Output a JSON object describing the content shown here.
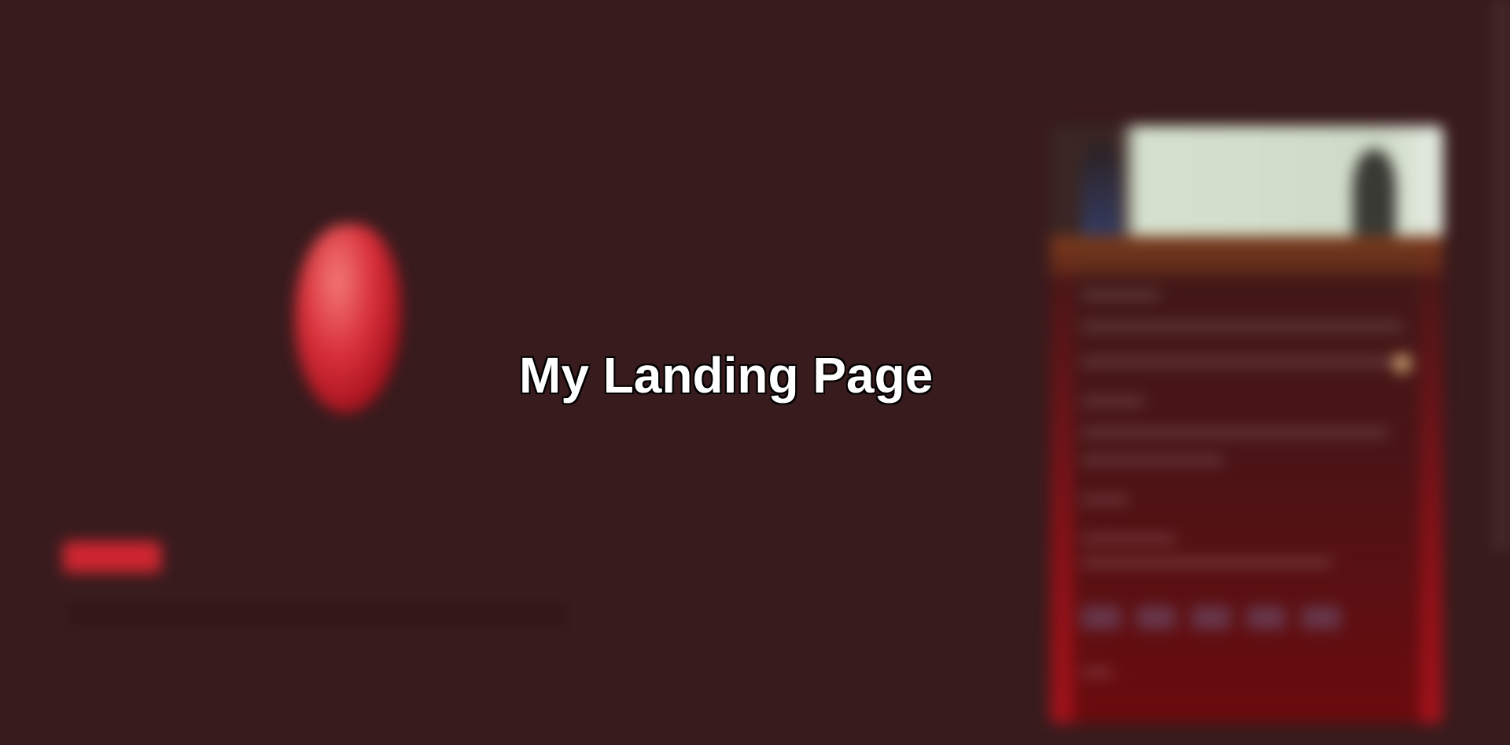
{
  "overlay": {
    "title": "My Landing Page"
  },
  "colors": {
    "background": "#381b1d",
    "accent": "#cf2631",
    "text": "#ffffff"
  },
  "icons": [
    "logo-icon",
    "hero-image-icon"
  ]
}
